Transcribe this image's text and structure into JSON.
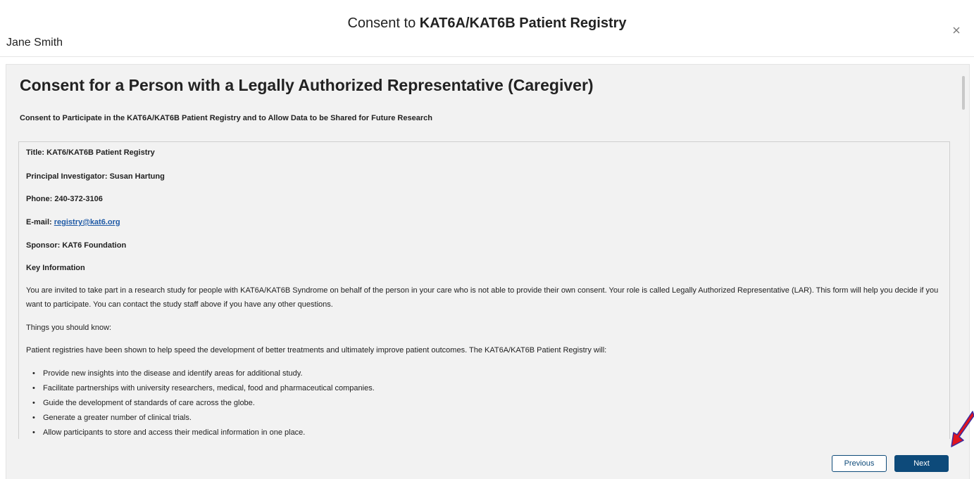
{
  "modal": {
    "title_prefix": "Consent to ",
    "title_bold": "KAT6A/KAT6B Patient Registry",
    "user_name": "Jane Smith",
    "close_label": "×"
  },
  "content": {
    "heading": "Consent for a Person with a Legally Authorized Representative (Caregiver)",
    "subheading": "Consent to Participate in the KAT6A/KAT6B Patient Registry and to Allow Data to be Shared for Future Research",
    "title_line": "Title: KAT6/KAT6B Patient Registry",
    "pi_line": "Principal Investigator: Susan Hartung",
    "phone_line": "Phone: 240-372-3106",
    "email_label": "E-mail: ",
    "email_link": "registry@kat6.org",
    "sponsor_line": "Sponsor: KAT6 Foundation",
    "key_info_heading": "Key Information",
    "intro_paragraph": "You are invited to take part in a research study for people with KAT6A/KAT6B Syndrome on behalf of the person in your care who is not able to provide their own consent. Your role is called Legally Authorized Representative (LAR). This form will help you decide if you want to participate. You can contact the study staff above if you have any other questions.",
    "things_heading": "Things you should know:",
    "registry_paragraph": "Patient registries have been shown to help speed the development of better treatments and ultimately improve patient outcomes. The KAT6A/KAT6B Patient Registry will:",
    "bullets": [
      "Provide new insights into the disease and identify areas for additional study.",
      "Facilitate partnerships with university researchers, medical, food and pharmaceutical companies.",
      "Guide the development of standards of care across the globe.",
      "Generate a greater number of clinical trials.",
      "Allow participants to store and access their medical information in one place."
    ]
  },
  "footer": {
    "previous_label": "Previous",
    "next_label": "Next"
  },
  "colors": {
    "primary": "#0d4a7a",
    "link": "#1f5aa6",
    "annotation_arrow": "#e0141e"
  }
}
